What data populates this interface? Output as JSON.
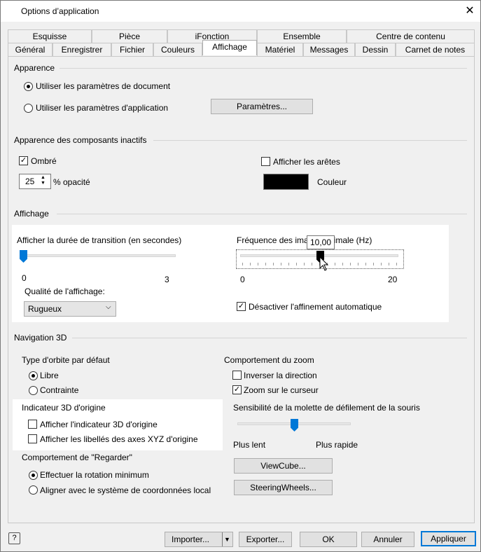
{
  "window": {
    "title": "Options d’application",
    "close_icon": "close-icon"
  },
  "tabs": {
    "row1": [
      "Esquisse",
      "Pièce",
      "iFonction",
      "Ensemble",
      "Centre de contenu"
    ],
    "row2": [
      "Général",
      "Enregistrer",
      "Fichier",
      "Couleurs",
      "Affichage",
      "Matériel",
      "Messages",
      "Dessin",
      "Carnet de notes"
    ]
  },
  "apparence": {
    "title": "Apparence",
    "radio_doc": "Utiliser les paramètres de document",
    "radio_app": "Utiliser les paramètres d'application",
    "params_button": "Paramètres..."
  },
  "inactifs": {
    "title": "Apparence des composants inactifs",
    "ombre": "Ombré",
    "opacite_value": "25",
    "opacite_label": "% opacité",
    "aretes": "Afficher les arêtes",
    "couleur": "Couleur",
    "swatch_color": "#000000"
  },
  "affichage": {
    "title": "Affichage",
    "transition_label": "Afficher la durée de transition (en secondes)",
    "transition_min": "0",
    "transition_max": "3",
    "transition_value": 0,
    "frequence_label_left": "Fréquence des ima",
    "frequence_label_right": "nimale (Hz)",
    "frequence_tooltip": "10,00",
    "frequence_min": "0",
    "frequence_max": "20",
    "frequence_value": 10,
    "qualite_label": "Qualité de l'affichage:",
    "qualite_value": "Rugueux",
    "affinement": "Désactiver l'affinement automatique"
  },
  "navigation": {
    "title": "Navigation 3D",
    "orbite_title": "Type d'orbite par défaut",
    "libre": "Libre",
    "contrainte": "Contrainte",
    "indicateur_title": "Indicateur 3D d'origine",
    "afficher_indicateur": "Afficher l'indicateur 3D d'origine",
    "afficher_libelles": "Afficher les libellés des axes XYZ d'origine",
    "regarder_title": "Comportement de \"Regarder\"",
    "rotation_min": "Effectuer la rotation minimum",
    "aligner": "Aligner avec le système de coordonnées local",
    "zoom_title": "Comportement du zoom",
    "inverser": "Inverser la direction",
    "zoom_curseur": "Zoom sur le curseur",
    "sensibilite": "Sensibilité de la molette de défilement de la souris",
    "plus_lent": "Plus lent",
    "plus_rapide": "Plus rapide",
    "sensibilite_value": 0.5,
    "viewcube": "ViewCube...",
    "steeringwheels": "SteeringWheels..."
  },
  "footer": {
    "help_icon": "help-icon",
    "importer": "Importer...",
    "exporter": "Exporter...",
    "ok": "OK",
    "annuler": "Annuler",
    "appliquer": "Appliquer"
  }
}
